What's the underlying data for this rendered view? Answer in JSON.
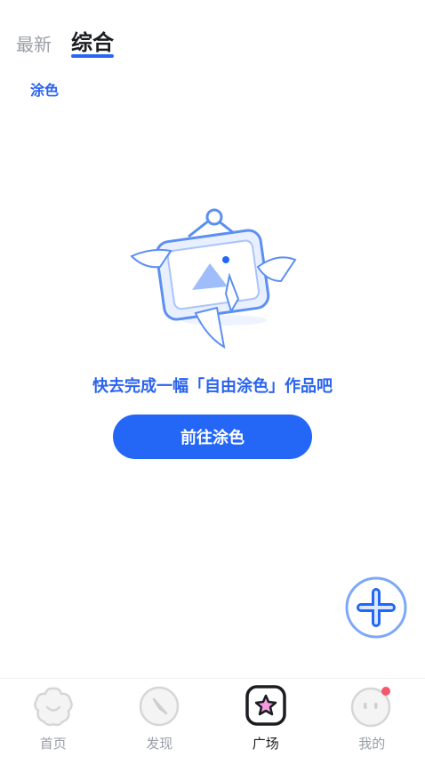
{
  "header": {
    "tabs": [
      {
        "label": "最新",
        "active": false
      },
      {
        "label": "综合",
        "active": true
      }
    ]
  },
  "filter": {
    "chip_label": "涂色"
  },
  "empty_state": {
    "message": "快去完成一幅「自由涂色」作品吧",
    "button_label": "前往涂色"
  },
  "fab": {
    "icon": "plus-icon"
  },
  "bottom_nav": {
    "items": [
      {
        "label": "首页",
        "icon": "flower-icon",
        "active": false
      },
      {
        "label": "发现",
        "icon": "compass-icon",
        "active": false
      },
      {
        "label": "广场",
        "icon": "plaza-icon",
        "active": true
      },
      {
        "label": "我的",
        "icon": "profile-face-icon",
        "active": false,
        "badge_dot": true
      }
    ]
  },
  "colors": {
    "accent": "#2466f6",
    "badge": "#f5586b",
    "plaza_icon": "#f39be0"
  }
}
